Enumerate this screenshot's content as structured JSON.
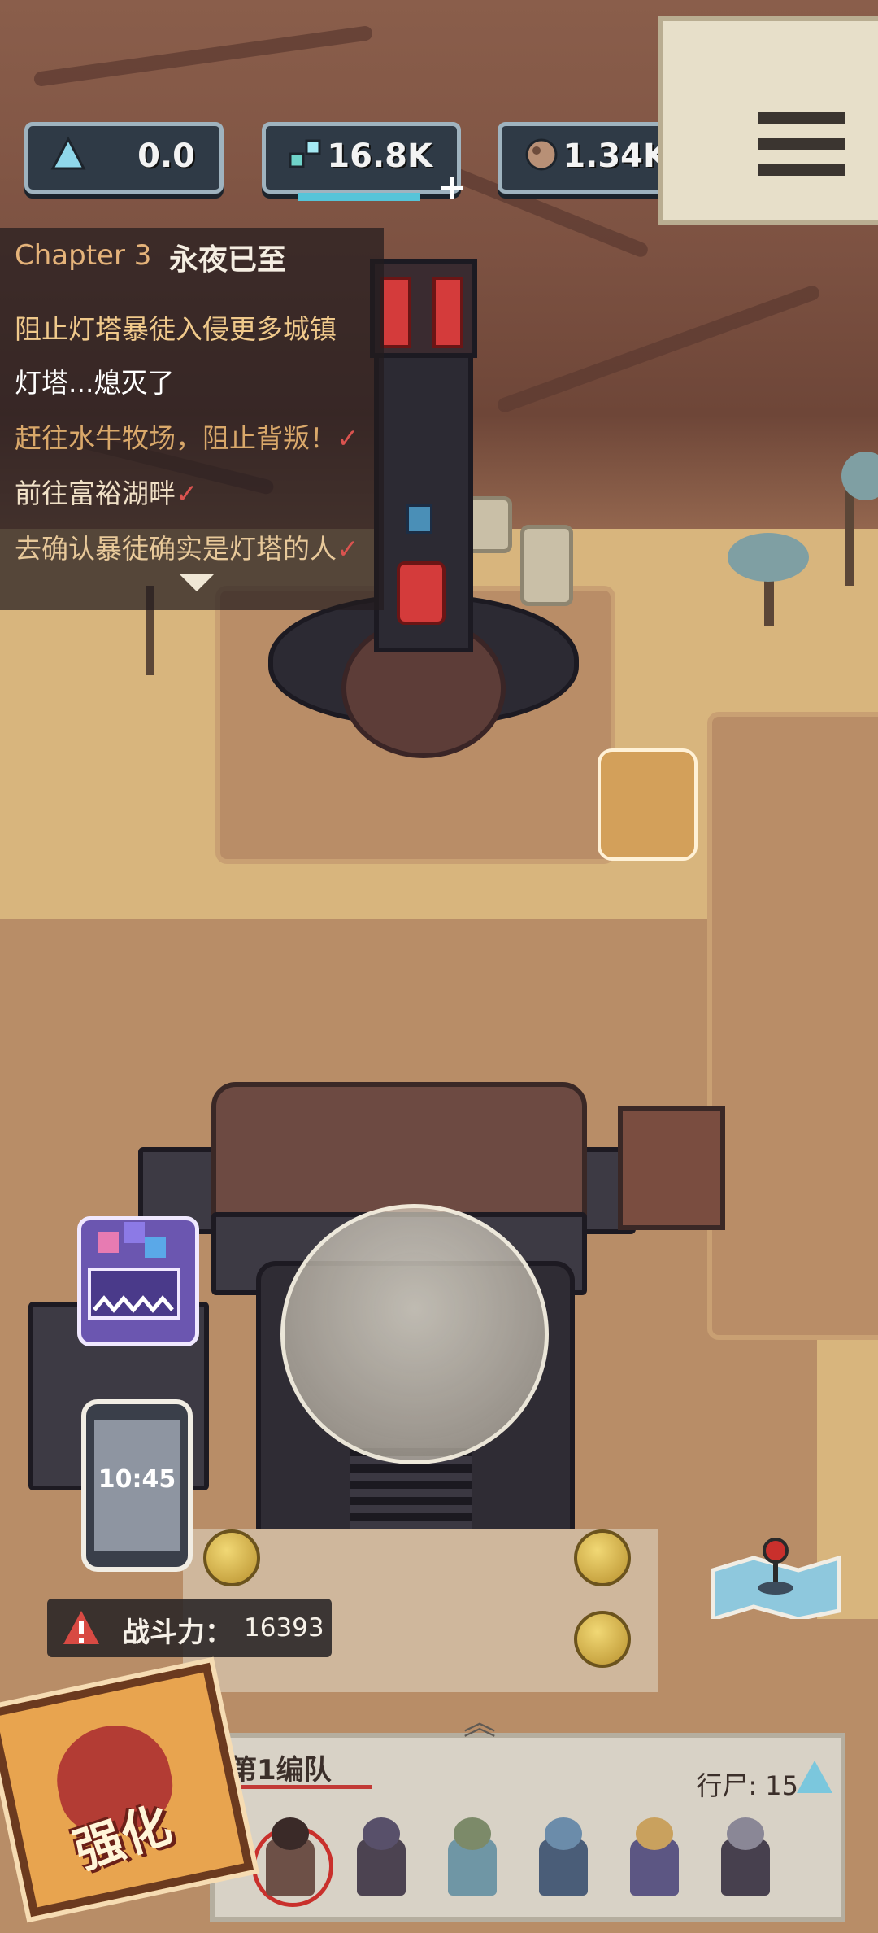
{
  "resources": [
    {
      "icon": "triangle-icon",
      "value": "0.0",
      "plus": false
    },
    {
      "icon": "gems-icon",
      "value": "16.8K",
      "plus": true
    },
    {
      "icon": "ore-icon",
      "value": "1.34K",
      "plus": true
    }
  ],
  "quest": {
    "chapter_label": "Chapter 3",
    "chapter_name": "永夜已至",
    "items": [
      {
        "text": "阻止灯塔暴徒入侵更多城镇",
        "done": false,
        "color": "#f0c98b"
      },
      {
        "text": "灯塔...熄灭了",
        "done": false,
        "color": "#ffffff"
      },
      {
        "text": "赶往水牛牧场，阻止背叛！",
        "done": true,
        "color": "#d9a86a"
      },
      {
        "text": "前往富裕湖畔",
        "done": true,
        "color": "#f0e0c6"
      },
      {
        "text": "去确认暴徒确实是灯塔的人",
        "done": true,
        "color": "#e8c99a"
      }
    ],
    "check_mark": "✓"
  },
  "phone": {
    "time": "10:45"
  },
  "combat": {
    "label": "战斗力：",
    "value": "16393"
  },
  "enhance": {
    "label": "强化"
  },
  "squad": {
    "title": "第1编队",
    "stat_label": "行尸: 15",
    "units": [
      {
        "name": "unit-reaper",
        "selected": true,
        "body": "#6d5047",
        "head": "#3a2a28"
      },
      {
        "name": "unit-cat",
        "selected": false,
        "body": "#4c4351",
        "head": "#58506a"
      },
      {
        "name": "unit-hedgehog",
        "selected": false,
        "body": "#6f96a5",
        "head": "#7c8a69"
      },
      {
        "name": "unit-axe-zombie",
        "selected": false,
        "body": "#4a5d78",
        "head": "#6b8caa"
      },
      {
        "name": "unit-bandit",
        "selected": false,
        "body": "#5c5683",
        "head": "#c9a15e"
      },
      {
        "name": "unit-skull",
        "selected": false,
        "body": "#47404e",
        "head": "#8a8796"
      }
    ]
  },
  "colors": {
    "accent_red": "#c9302c",
    "hud_blue": "#56c4d9",
    "panel_dark": "#221c1e"
  }
}
